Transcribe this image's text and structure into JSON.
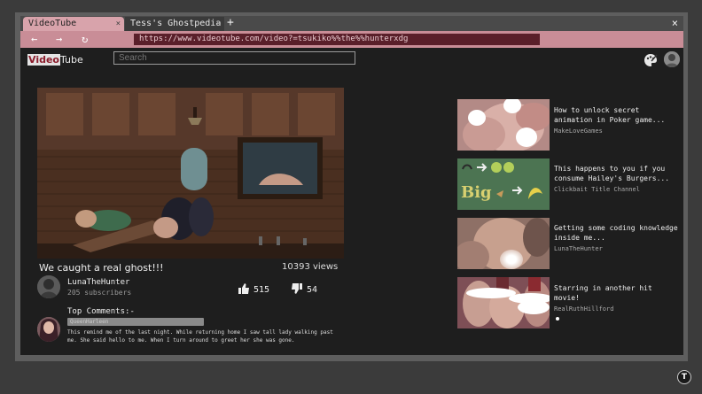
{
  "browser": {
    "tabs": [
      {
        "label": "VideoTube",
        "close": "×"
      },
      {
        "label": "Tess's Ghostpedia",
        "close": "×"
      }
    ],
    "new_tab": "+",
    "window_close": "×",
    "nav": {
      "back": "←",
      "forward": "→",
      "reload": "↻"
    },
    "url": "https://www.videotube.com/video?=tsukiko%%the%%hunterxdg"
  },
  "site": {
    "logo_prefix": "V",
    "logo_highlight": "ideo",
    "logo_suffix": "Tube",
    "search_placeholder": "Search"
  },
  "video": {
    "title": "We caught a real ghost!!!",
    "views": "10393 views",
    "channel": "LunaTheHunter",
    "subscribers": "205 subscribers",
    "likes": "515",
    "dislikes": "54"
  },
  "comments": {
    "heading": "Top Comments:-",
    "items": [
      {
        "author": "QueenHarleen",
        "text": "This remind me of the last night. While returning home I saw tall lady walking past me. She said hello to me. When I turn around to greet her she was gone."
      }
    ]
  },
  "recommendations": [
    {
      "title": "How to unlock secret animation in Poker game...",
      "channel": "MakeLoveGames"
    },
    {
      "title": "This happens to you if you consume Hailey's Burgers...",
      "channel": "Clickbait Title Channel"
    },
    {
      "title": "Getting some coding knowledge inside me...",
      "channel": "LunaTheHunter"
    },
    {
      "title": "Starring in another hit movie!",
      "channel": "RealRuthHillford"
    }
  ],
  "colors": {
    "active_tab": "#d8a3ab",
    "nav_bar": "#c98d97",
    "url_field": "#5a1f2a",
    "background": "#1e1e1e"
  },
  "icons": {
    "palette": "palette-icon",
    "profile": "profile-avatar",
    "like": "thumbs-up-icon",
    "dislike": "thumbs-down-icon",
    "corner": "t-badge-icon"
  }
}
